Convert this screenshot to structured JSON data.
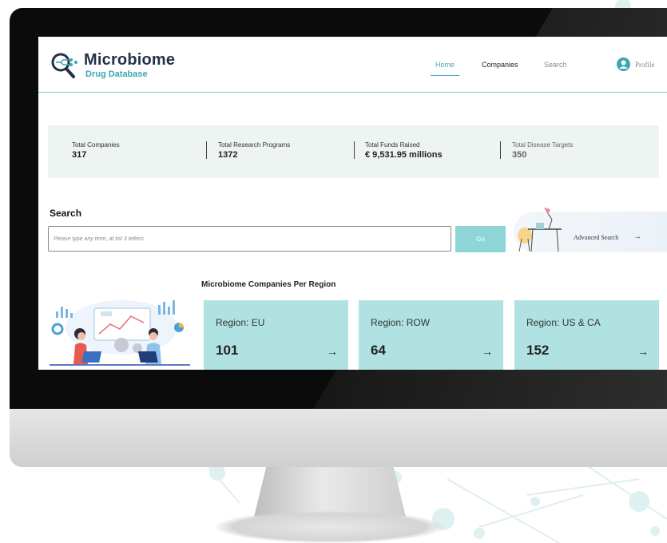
{
  "brand": {
    "title": "Microbiome",
    "subtitle": "Drug Database"
  },
  "nav": {
    "home": "Home",
    "companies": "Companies",
    "search": "Search",
    "profile": "Profile"
  },
  "stats": [
    {
      "label": "Total Companies",
      "value": "317"
    },
    {
      "label": "Total Research Programs",
      "value": "1372"
    },
    {
      "label": "Total Funds Raised",
      "value": "€ 9,531.95 millions"
    },
    {
      "label": "Total Disease Targets",
      "value": "350"
    }
  ],
  "search": {
    "title": "Search",
    "placeholder": "Please type any term, at list 3 letters",
    "value": "",
    "button": "Go"
  },
  "advanced_search": {
    "label": "Advanced Search",
    "arrow": "→"
  },
  "regions": {
    "title": "Microbiome Companies Per Region",
    "cards": [
      {
        "label": "Region: EU",
        "count": "101",
        "arrow": "→"
      },
      {
        "label": "Region: ROW",
        "count": "64",
        "arrow": "→"
      },
      {
        "label": "Region: US & CA",
        "count": "152",
        "arrow": "→"
      }
    ]
  },
  "colors": {
    "accent": "#3aa7b5",
    "card": "#afe2e1",
    "stats_bg": "#eef4f1",
    "go_button": "#8ed5d8",
    "brand_dark": "#23314a"
  },
  "icons": [
    "magnifier-logo-icon",
    "user-circle-icon",
    "arrow-right-icon",
    "desk-lamp-illustration",
    "office-team-illustration"
  ]
}
